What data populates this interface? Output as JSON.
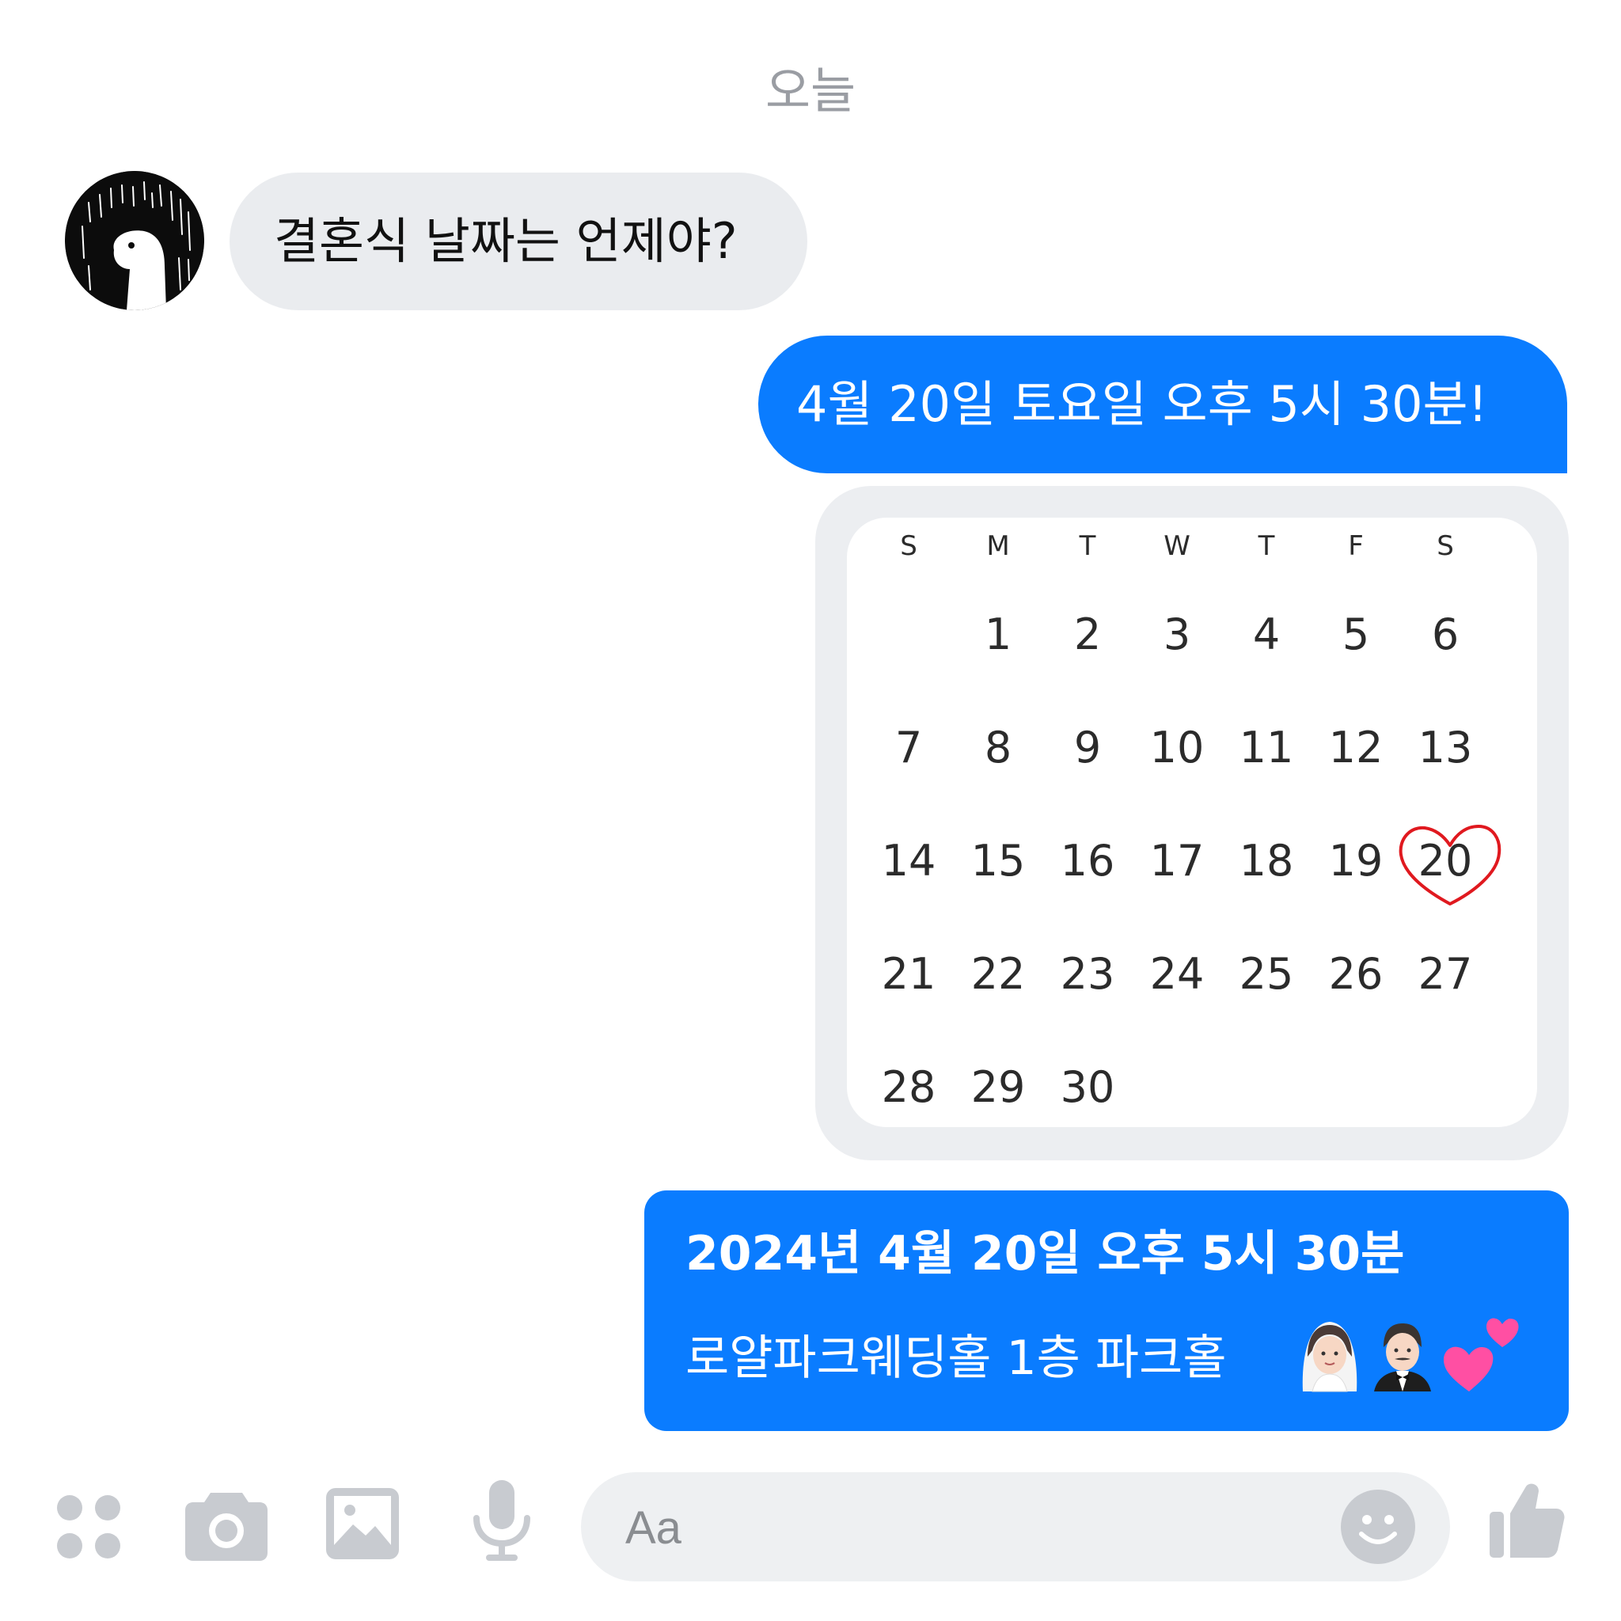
{
  "conversation": {
    "date_separator": "오늘",
    "incoming": {
      "text": "결혼식 날짜는 언제야?"
    },
    "outgoing": [
      {
        "text": "4월 20일 토요일 오후 5시 30분!"
      },
      {
        "line1": "2024년 4월 20일 오후 5시 30분",
        "line2": "로얄파크웨딩홀 1층 파크홀"
      }
    ]
  },
  "calendar": {
    "weekdays": [
      "S",
      "M",
      "T",
      "W",
      "T",
      "F",
      "S"
    ],
    "weeks": [
      [
        "",
        "1",
        "2",
        "3",
        "4",
        "5",
        "6"
      ],
      [
        "7",
        "8",
        "9",
        "10",
        "11",
        "12",
        "13"
      ],
      [
        "14",
        "15",
        "16",
        "17",
        "18",
        "19",
        "20"
      ],
      [
        "21",
        "22",
        "23",
        "24",
        "25",
        "26",
        "27"
      ],
      [
        "28",
        "29",
        "30",
        "",
        "",
        "",
        ""
      ]
    ],
    "highlighted_day": "20",
    "highlight_icon": "heart-outline-icon",
    "highlight_color": "#e0191f"
  },
  "emojis": [
    "bride-with-veil-icon",
    "man-in-tuxedo-icon",
    "two-hearts-icon"
  ],
  "toolbar": {
    "icons": [
      "apps-grid-icon",
      "camera-icon",
      "image-icon",
      "microphone-icon"
    ],
    "input_placeholder": "Aa",
    "emoji_button_icon": "smiley-icon",
    "like_button_icon": "thumbs-up-icon",
    "icon_color": "#c8cbd0"
  },
  "colors": {
    "outgoing_bubble": "#0a7cff",
    "incoming_bubble": "#eaecef",
    "date_separator_text": "#9a9da3"
  }
}
